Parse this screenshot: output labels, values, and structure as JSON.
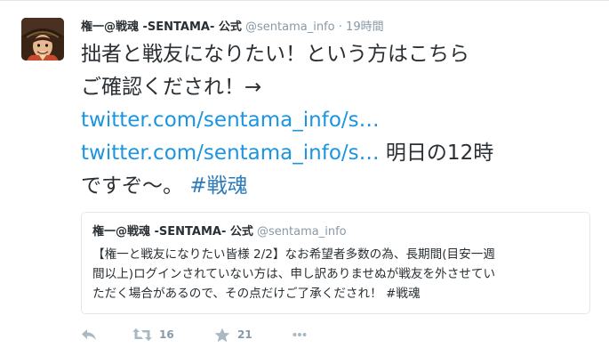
{
  "tweet": {
    "fullname": "権一@戦魂 -SENTAMA- 公式",
    "username": "@sentama_info",
    "dot": "·",
    "timestamp": "19時間",
    "text_line1": "拙者と戦友になりたい！という方はこちら",
    "text_line2": "ご確認くだされ！→",
    "link1": "twitter.com/sentama_info/s…",
    "link2": "twitter.com/sentama_info/s…",
    "text_after_link2": " 明日の12時",
    "text_line5": "ですぞ〜。 ",
    "hashtag": "#戦魂"
  },
  "quote": {
    "fullname": "権一@戦魂 -SENTAMA- 公式",
    "username": "@sentama_info",
    "line1": "【権一と戦友になりたい皆様 2/2】なお希望者多数の為、長期間(目安一週",
    "line2": "間以上)ログインされていない方は、申し訳ありませぬが戦友を外させてい",
    "line3": "ただく場合があるので、その点だけご了承くだされ！ #戦魂"
  },
  "actions": {
    "retweet_count": "16",
    "favorite_count": "21"
  },
  "colors": {
    "link": "#1b95e0",
    "hashtag": "#2b7bb9",
    "muted": "#8899a6",
    "text": "#292f33",
    "border": "#e1e8ed"
  },
  "icons": [
    "avatar",
    "reply-icon",
    "retweet-icon",
    "favorite-icon",
    "more-icon"
  ]
}
